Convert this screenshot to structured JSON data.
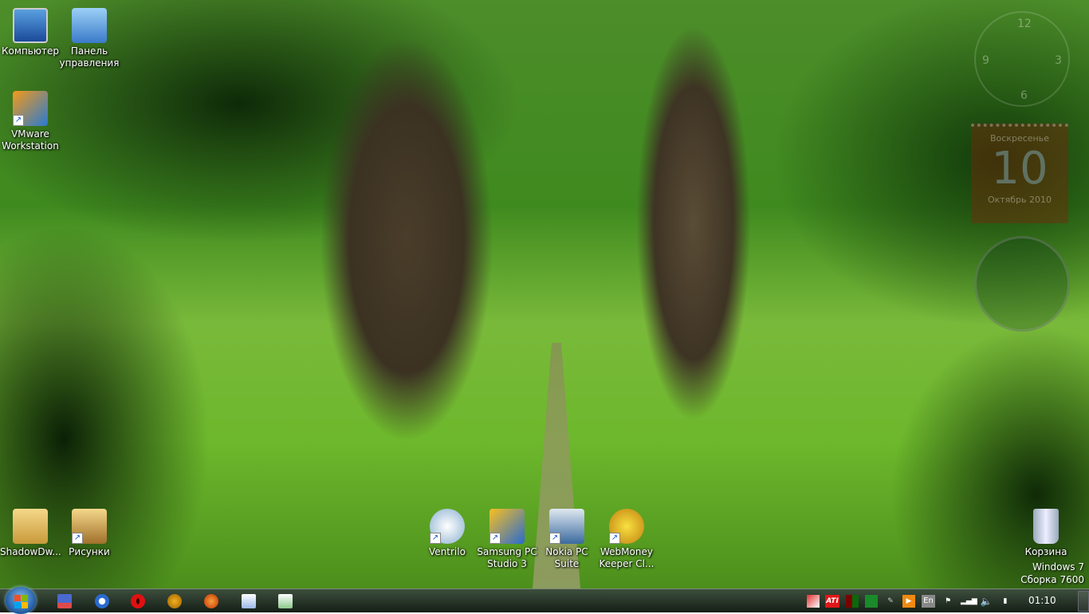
{
  "desktop_icons": [
    {
      "label": "Компьютер"
    },
    {
      "label": "Панель управления"
    },
    {
      "label": "VMware Workstation"
    },
    {
      "label": "ShadowDw..."
    },
    {
      "label": "Рисунки"
    },
    {
      "label": "Ventrilo"
    },
    {
      "label": "Samsung PC Studio 3"
    },
    {
      "label": "Nokia PC Suite"
    },
    {
      "label": "WebMoney Keeper Cl..."
    },
    {
      "label": "Корзина"
    }
  ],
  "watermark": {
    "line1": "Windows 7",
    "line2": "Сборка 7600"
  },
  "calendar_gadget": {
    "weekday": "Воскресенье",
    "day": "10",
    "month_year": "Октябрь 2010"
  },
  "clock_gadget": {
    "numerals": [
      "12",
      "3",
      "6",
      "9"
    ]
  },
  "taskbar": {
    "pinned": [
      "save-icon",
      "maxthon-icon",
      "opera-icon",
      "aimp-icon",
      "firefox-icon",
      "word-icon",
      "excel-icon"
    ],
    "tray": {
      "language": "En",
      "ati": "ATI"
    },
    "time": "01:10"
  }
}
